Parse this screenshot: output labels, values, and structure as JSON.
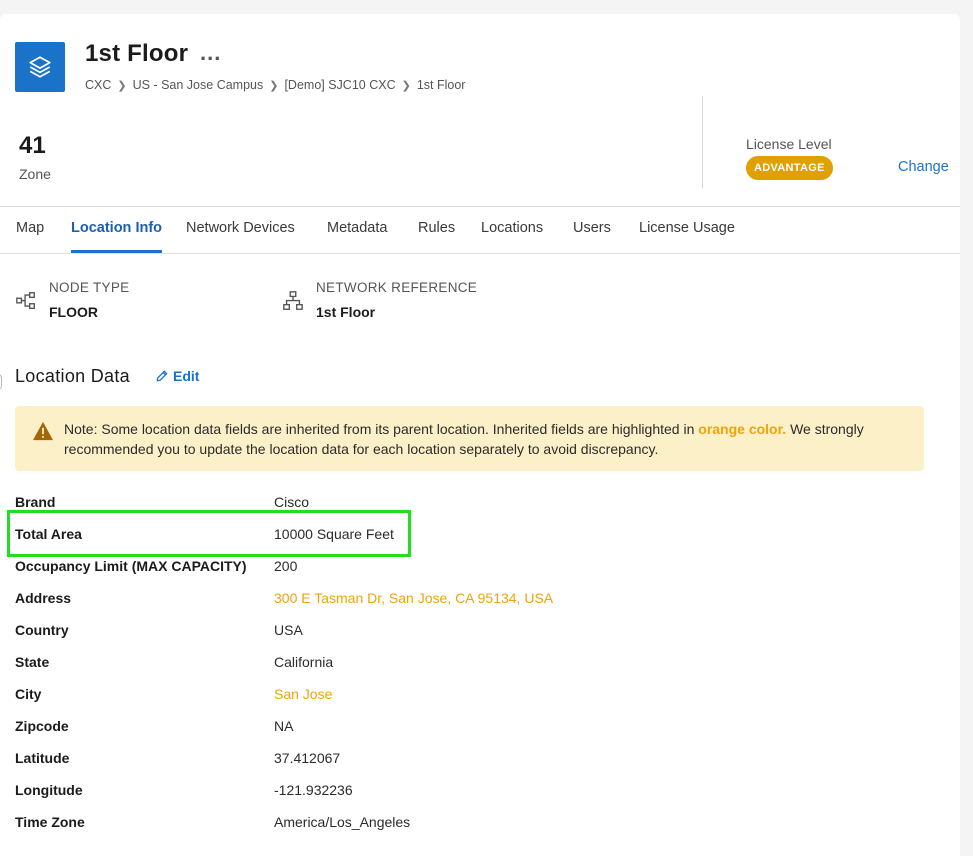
{
  "header": {
    "title": "1st Floor",
    "more_label": "...",
    "breadcrumb": [
      "CXC",
      "US - San Jose Campus",
      "[Demo] SJC10 CXC",
      "1st Floor"
    ],
    "app_icon": "layers-icon"
  },
  "stats": {
    "count": "41",
    "count_label": "Zone"
  },
  "license": {
    "label": "License Level",
    "level": "ADVANTAGE",
    "change_label": "Change",
    "badge_color": "#e0a100"
  },
  "tabs": [
    {
      "label": "Map",
      "active": false
    },
    {
      "label": "Location Info",
      "active": true
    },
    {
      "label": "Network Devices",
      "active": false
    },
    {
      "label": "Metadata",
      "active": false
    },
    {
      "label": "Rules",
      "active": false
    },
    {
      "label": "Locations",
      "active": false
    },
    {
      "label": "Users",
      "active": false
    },
    {
      "label": "License Usage",
      "active": false
    }
  ],
  "node_info": {
    "node_type_label": "NODE TYPE",
    "node_type_value": "FLOOR",
    "network_ref_label": "NETWORK REFERENCE",
    "network_ref_value": "1st Floor"
  },
  "location_data": {
    "title": "Location Data",
    "edit_label": "Edit",
    "note": {
      "prefix": "Note: Some location data fields are inherited from its parent location. Inherited fields are highlighted in ",
      "highlight": "orange color.",
      "suffix": " We strongly recommended you to update the location data for each location separately to avoid discrepancy."
    },
    "fields": [
      {
        "key": "Brand",
        "value": "Cisco",
        "inherited": false
      },
      {
        "key": "Total Area",
        "value": "10000 Square Feet",
        "inherited": false
      },
      {
        "key": "Occupancy Limit (MAX CAPACITY)",
        "value": "200",
        "inherited": false
      },
      {
        "key": "Address",
        "value": "300 E Tasman Dr, San Jose, CA 95134, USA",
        "inherited": true
      },
      {
        "key": "Country",
        "value": "USA",
        "inherited": false
      },
      {
        "key": "State",
        "value": "California",
        "inherited": false
      },
      {
        "key": "City",
        "value": "San Jose",
        "inherited": true
      },
      {
        "key": "Zipcode",
        "value": "NA",
        "inherited": false
      },
      {
        "key": "Latitude",
        "value": "37.412067",
        "inherited": false
      },
      {
        "key": "Longitude",
        "value": "-121.932236",
        "inherited": false
      },
      {
        "key": "Time Zone",
        "value": "America/Los_Angeles",
        "inherited": false
      }
    ]
  },
  "colors": {
    "accent": "#1a73c8",
    "inherited": "#f0a30a",
    "note_bg": "#fbf0c8",
    "highlight_box": "#22dd22"
  }
}
